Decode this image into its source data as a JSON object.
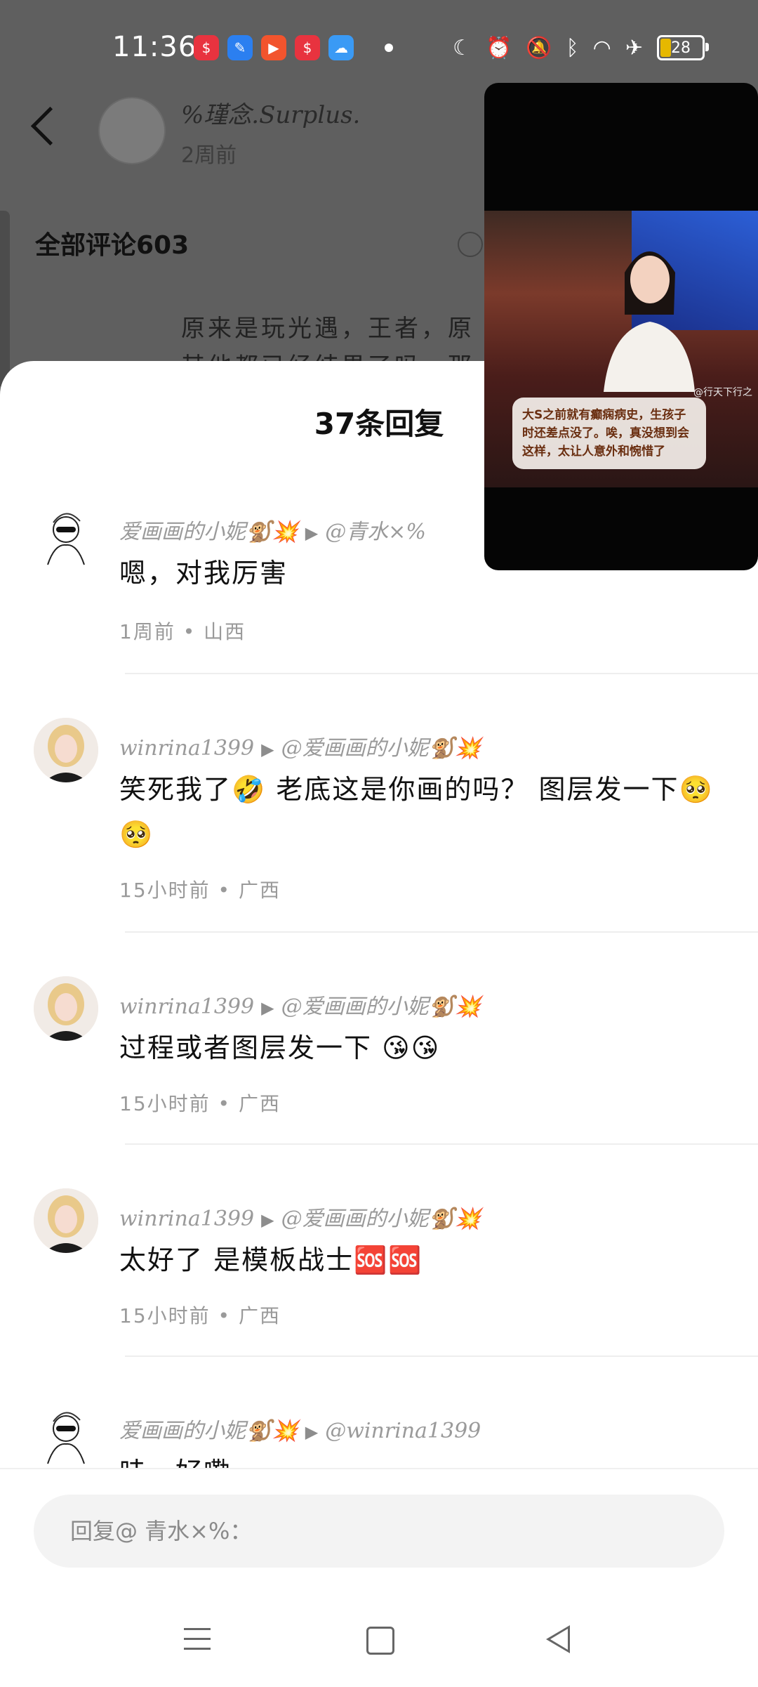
{
  "status_bar": {
    "time": "11:36",
    "battery": "28",
    "app_icons": [
      "dollar-icon",
      "brush-icon",
      "video-play-icon",
      "dollar-icon",
      "weather-icon"
    ],
    "system_icons": [
      "moon-icon",
      "alarm-icon",
      "bell-off-icon",
      "bluetooth-icon",
      "wifi-icon",
      "airplane-icon"
    ]
  },
  "background_page": {
    "author_name": "%瑾念.Surplus.",
    "post_time": "2周前",
    "all_comments": "全部评论603",
    "comment_line1": "原来是玩光遇，王者，原",
    "comment_line2": "其他都已经结果了吗，那"
  },
  "sheet": {
    "title": "37条回复",
    "replies": [
      {
        "user": "爱画画的小妮🐒💥",
        "reply_to": "@青水×%",
        "text": "嗯，对我厉害",
        "info": "1周前 • 山西",
        "avatar": "sketch"
      },
      {
        "user": "winrina1399",
        "reply_to": "@爱画画的小妮🐒💥",
        "text": "笑死我了🤣 老底这是你画的吗？ 图层发一下🥺🥺",
        "info": "15小时前 • 广西",
        "avatar": "girl"
      },
      {
        "user": "winrina1399",
        "reply_to": "@爱画画的小妮🐒💥",
        "text": "过程或者图层发一下 😘😘",
        "info": "15小时前 • 广西",
        "avatar": "girl"
      },
      {
        "user": "winrina1399",
        "reply_to": "@爱画画的小妮🐒💥",
        "text": "太好了 是模板战士🆘🆘",
        "info": "15小时前 • 广西",
        "avatar": "girl"
      },
      {
        "user": "爱画画的小妮🐒💥",
        "reply_to": "@winrina1399",
        "text": "哇，好嘞",
        "info": "",
        "avatar": "sketch"
      }
    ]
  },
  "input": {
    "placeholder": "回复@ 青水×%："
  },
  "video": {
    "caption": "大S之前就有癫痫病史，生孩子时还差点没了。唉，真没想到会这样，太让人意外和惋惜了",
    "watermark": "@行天下行之"
  },
  "colors": {
    "overlay": "#5f5f5f",
    "sheet": "#ffffff",
    "meta_text": "#9a9a9a",
    "caption_text": "#6a2e10"
  }
}
